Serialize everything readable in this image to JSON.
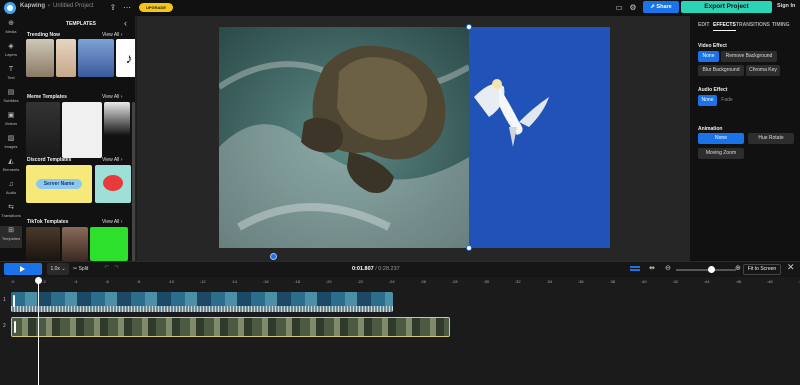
{
  "header": {
    "brand": "Kapwing",
    "project": "Untitled Project",
    "upgrade": "UPGRADE",
    "share": "Share",
    "export": "Export Project",
    "signin": "Sign In"
  },
  "sidebar": {
    "items": [
      {
        "label": "Media",
        "icon": "plus-icon"
      },
      {
        "label": "Layers",
        "icon": "layers-icon"
      },
      {
        "label": "Text",
        "icon": "text-icon"
      },
      {
        "label": "Subtitles",
        "icon": "subtitles-icon"
      },
      {
        "label": "Videos",
        "icon": "video-icon"
      },
      {
        "label": "Images",
        "icon": "image-icon"
      },
      {
        "label": "Elements",
        "icon": "elements-icon"
      },
      {
        "label": "Audio",
        "icon": "music-icon"
      },
      {
        "label": "Transitions",
        "icon": "transitions-icon"
      },
      {
        "label": "Templates",
        "icon": "templates-icon"
      }
    ]
  },
  "templates": {
    "title": "TEMPLATES",
    "sections": [
      {
        "title": "Trending Now",
        "view_all": "View All ›"
      },
      {
        "title": "Meme Templates",
        "view_all": "View All ›"
      },
      {
        "title": "Discord Templates",
        "view_all": "View All ›"
      },
      {
        "title": "TikTok Templates",
        "view_all": "View All ›"
      }
    ],
    "banner_text": "Server Name"
  },
  "right_panel": {
    "tabs": [
      "EDIT",
      "EFFECTS",
      "TRANSITIONS",
      "TIMING"
    ],
    "active_tab": "EFFECTS",
    "video_effect": {
      "label": "Video Effect",
      "options": [
        "None",
        "Remove Background",
        "Blur Background",
        "Chroma Key"
      ],
      "selected": "None"
    },
    "audio_effect": {
      "label": "Audio Effect",
      "options": [
        "None",
        "Fade"
      ],
      "selected": "None"
    },
    "animation": {
      "label": "Animation",
      "options": [
        "None",
        "Hue Rotate",
        "Moving Zoom"
      ],
      "selected": "None"
    }
  },
  "toolbar": {
    "speed": "1.0x ⌄",
    "split": "✂ Split",
    "current_time": "0:01.807",
    "total_time": "/ 0:28.237",
    "fit": "Fit to Screen"
  },
  "timeline": {
    "ticks": [
      ":0",
      ":2",
      ":4",
      ":6",
      ":8",
      ":10",
      ":12",
      ":14",
      ":16",
      ":18",
      ":20",
      ":22",
      ":24",
      ":26",
      ":28",
      ":30",
      ":32",
      ":34",
      ":36",
      ":38",
      ":40",
      ":42",
      ":44",
      ":46",
      ":48",
      ":50"
    ],
    "tracks": [
      "1",
      "2"
    ]
  },
  "colors": {
    "accent": "#1a73e8",
    "export": "#2bd4b4",
    "upgrade": "#f5c518"
  }
}
